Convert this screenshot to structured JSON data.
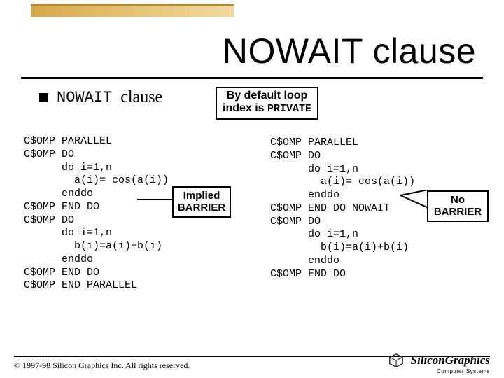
{
  "title": "NOWAIT clause",
  "subhead": {
    "kw": "NOWAIT",
    "word": "clause"
  },
  "boxes": {
    "private_l1": "By default loop",
    "private_l2a": "index is ",
    "private_l2b": "PRIVATE",
    "implied_l1": "Implied",
    "implied_l2": "BARRIER",
    "nob_l1": "No",
    "nob_l2": "BARRIER"
  },
  "code_left": "C$OMP PARALLEL\nC$OMP DO\n      do i=1,n\n        a(i)= cos(a(i))\n      enddo\nC$OMP END DO\nC$OMP DO\n      do i=1,n\n        b(i)=a(i)+b(i)\n      enddo\nC$OMP END DO\nC$OMP END PARALLEL",
  "code_right": "C$OMP PARALLEL\nC$OMP DO\n      do i=1,n\n        a(i)= cos(a(i))\n      enddo\nC$OMP END DO NOWAIT\nC$OMP DO\n      do i=1,n\n        b(i)=a(i)+b(i)\n      enddo\nC$OMP END DO",
  "footer": "© 1997-98 Silicon Graphics Inc. All rights reserved.",
  "logo": {
    "brand": "SiliconGraphics",
    "sub": "Computer Systems"
  }
}
